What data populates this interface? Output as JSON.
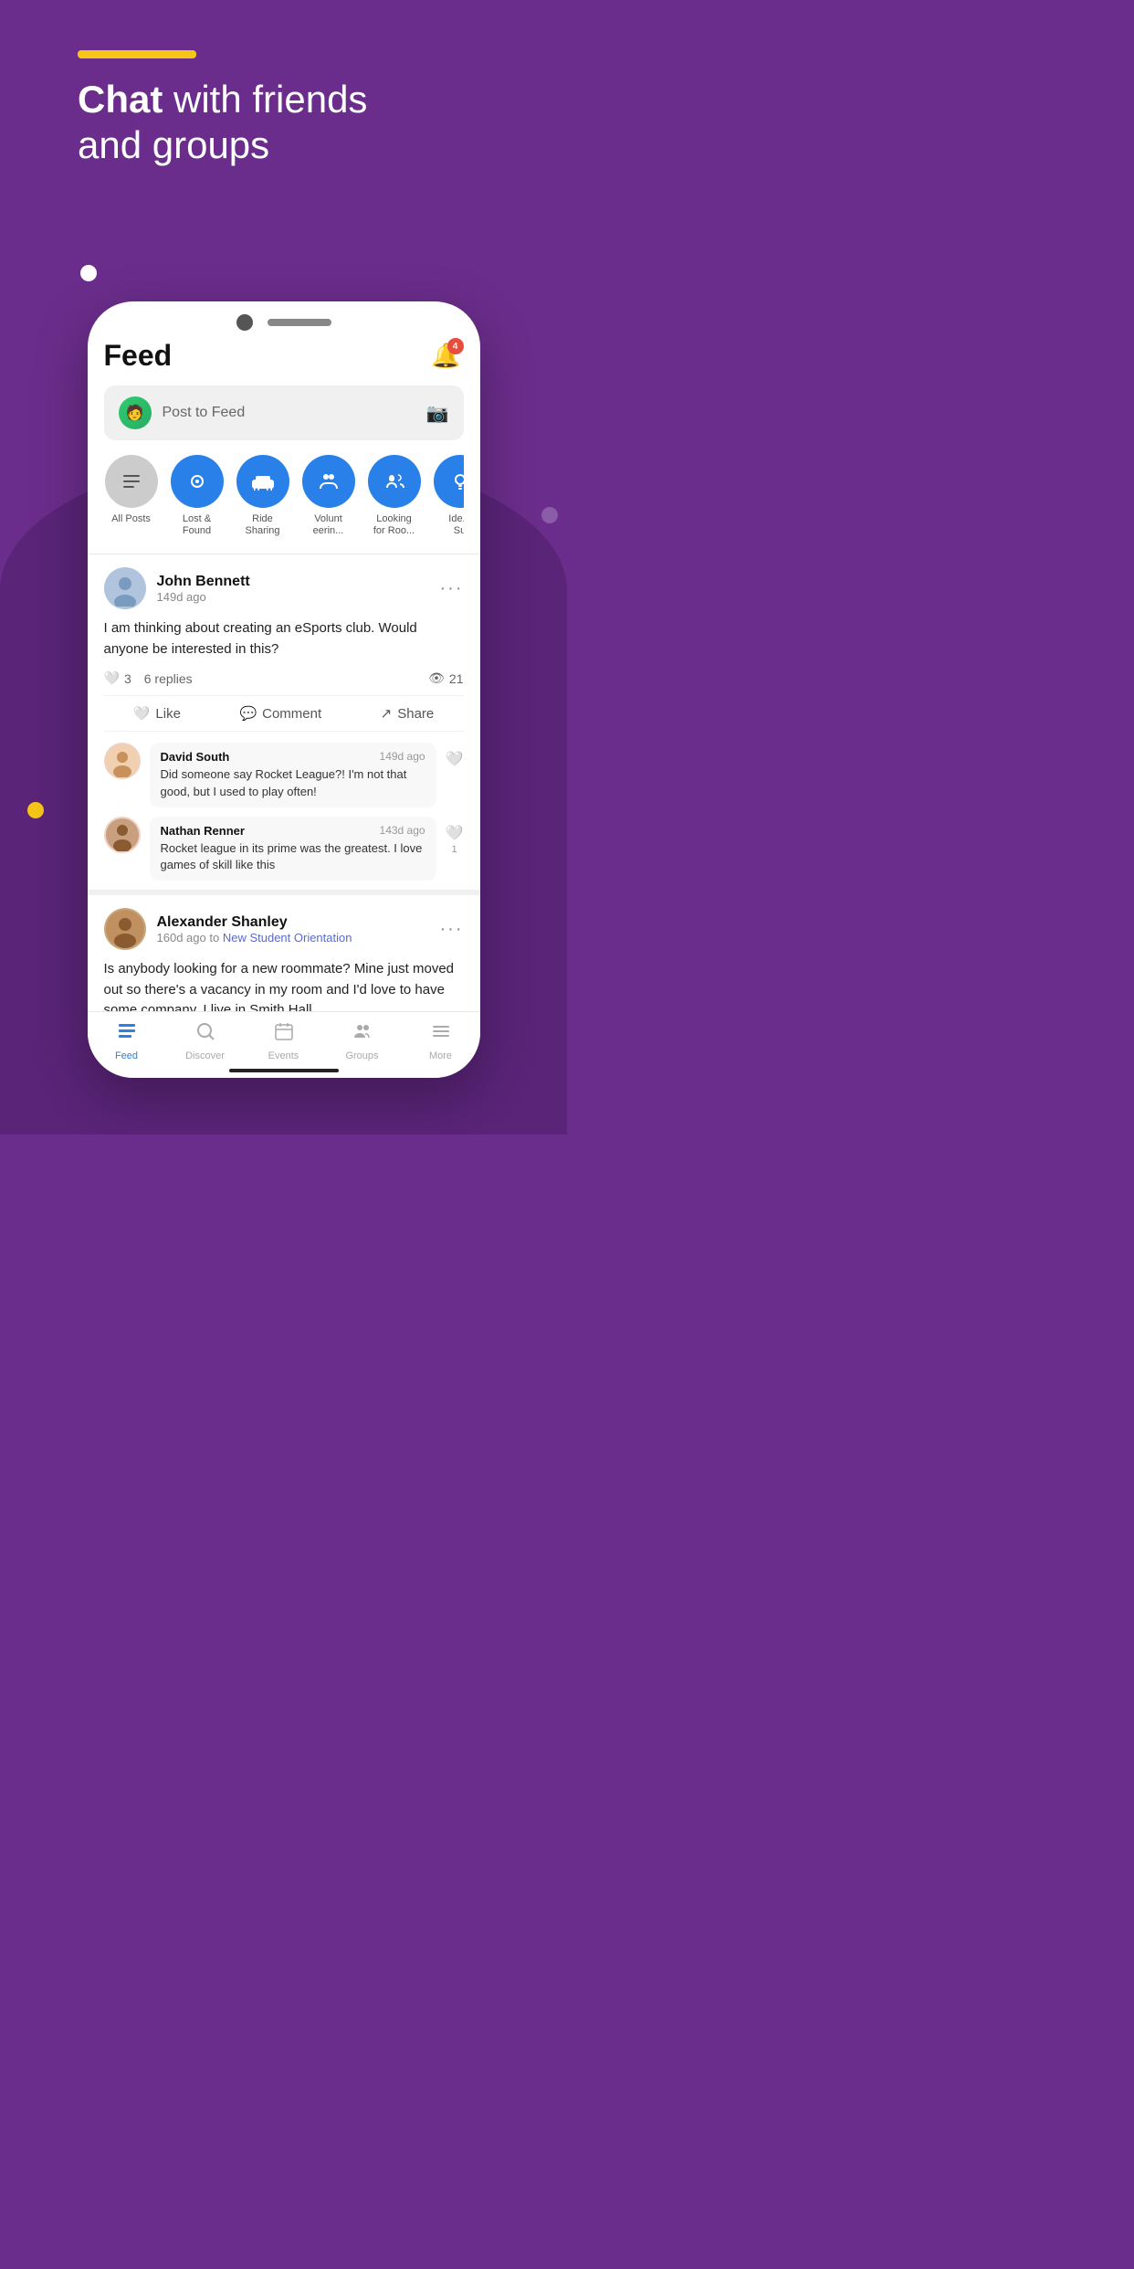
{
  "background": {
    "color": "#6B2D8B"
  },
  "header": {
    "yellow_bar": "",
    "headline_bold": "Chat",
    "headline_rest": " with friends\nand groups"
  },
  "phone": {
    "feed_title": "Feed",
    "notification_badge": "4",
    "post_placeholder": "Post to Feed",
    "categories": [
      {
        "label": "All Posts",
        "icon": "☰",
        "style": "gray"
      },
      {
        "label": "Lost &\nFound",
        "icon": "👁",
        "style": "blue"
      },
      {
        "label": "Ride\nSharing",
        "icon": "🚗",
        "style": "blue"
      },
      {
        "label": "Volunt\neerin...",
        "icon": "👥",
        "style": "blue"
      },
      {
        "label": "Looking\nfor Roo...",
        "icon": "📞",
        "style": "blue"
      },
      {
        "label": "Ide...\nSu",
        "icon": "💡",
        "style": "blue"
      }
    ],
    "post1": {
      "user_name": "John Bennett",
      "time": "149d ago",
      "text": "I am thinking about creating an eSports club. Would anyone be interested in this?",
      "likes": "3",
      "replies": "6 replies",
      "views": "21",
      "actions": [
        "Like",
        "Comment",
        "Share"
      ],
      "comments": [
        {
          "name": "David South",
          "time": "149d ago",
          "text": "Did someone say Rocket League?! I'm not that good, but I used to play often!",
          "likes": ""
        },
        {
          "name": "Nathan Renner",
          "time": "143d ago",
          "text": "Rocket league in its prime was the greatest. I love games of skill like this",
          "likes": "1"
        }
      ]
    },
    "post2": {
      "user_name": "Alexander Shanley",
      "time": "160d ago",
      "group": "New Student Orientation",
      "text": "Is anybody looking for a new roommate? Mine just moved out so there's a vacancy in my room and I'd love to have some company. I live in Smith Hall."
    },
    "bottom_nav": [
      {
        "label": "Feed",
        "icon": "📋",
        "active": true
      },
      {
        "label": "Discover",
        "icon": "🔍",
        "active": false
      },
      {
        "label": "Events",
        "icon": "📅",
        "active": false
      },
      {
        "label": "Groups",
        "icon": "👥",
        "active": false
      },
      {
        "label": "More",
        "icon": "☰",
        "active": false
      }
    ]
  }
}
